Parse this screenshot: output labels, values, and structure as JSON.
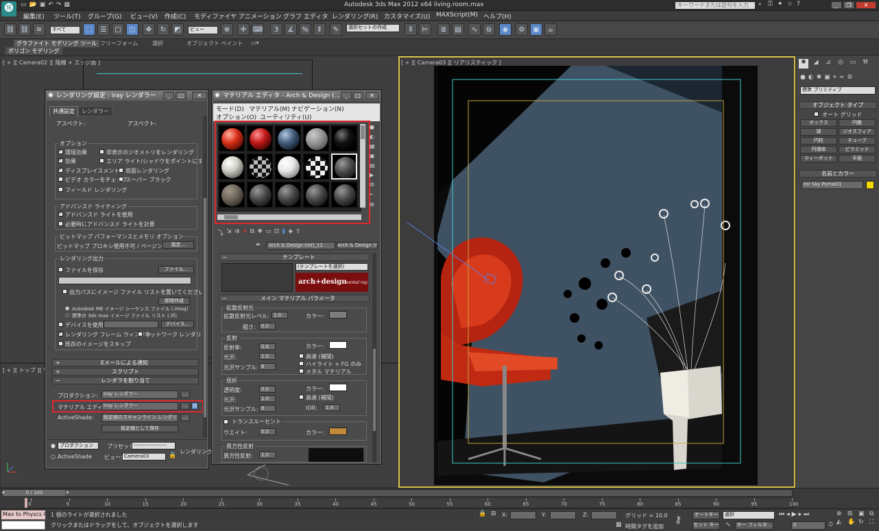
{
  "app": {
    "title": "Autodesk 3ds Max  2012 x64    living.room.max",
    "search_placeholder": "キーワードまたは語句を入力"
  },
  "menu": {
    "items": [
      "編集(E)",
      "ツール(T)",
      "グループ(G)",
      "ビュー(V)",
      "作成(C)",
      "モディファイヤ",
      "アニメーション",
      "グラフ エディタ",
      "レンダリング(R)",
      "カスタマイズ(U)",
      "MAXScript(M)",
      "ヘルプ(H)"
    ]
  },
  "toolbar": {
    "selection_filter": "すべて",
    "ref_coord": "ビュー",
    "named_selection": "選択セットの作成"
  },
  "ribbon": {
    "tabs": [
      "グラファイト モデリング ツール",
      "フリーフォーム",
      "選択",
      "オブジェクト ペイント"
    ],
    "subtab": "ポリゴン モデリング"
  },
  "viewports": {
    "top_left_label": "[ + ][ Camera02 ][ 陰線 + エッジ面 ]",
    "bottom_left_label": "[ + ][ トップ ][ ワイヤ",
    "right_label": "[ + ][ Camera03 ][ リアリスティック ]"
  },
  "render_setup": {
    "title": "レンダリング設定 : iray レンダラー",
    "tabs": [
      "共通設定",
      "レンダラー"
    ],
    "aspect_label": "アスペクト:",
    "aspect_label2": "アスペクト:",
    "options": {
      "title": "オプション",
      "atmospherics": "環境効果",
      "render_hidden": "非表示のジオメトリをレンダリング",
      "effects": "効果",
      "area_lights": "エリア ライト/シャドウをポイントにする",
      "displacement": "ディスプレイスメント",
      "force_2sided": "両面レンダリング",
      "video_check": "ビデオ カラーをチェック",
      "super_black": "スーパー ブラック",
      "render_fields": "フィールド レンダリング"
    },
    "advanced_lighting": {
      "title": "アドバンスド ライティング",
      "use": "アドバンスド ライトを使用",
      "compute": "必要時にアドバンスド ライトを計算"
    },
    "bitmap_perf": {
      "title": "ビットマップ パフォーマンスとメモリ オプション",
      "text": "ビットマップ プロキシ使用不可 / ページング使用",
      "setup_btn": "設定..."
    },
    "render_output": {
      "title": "レンダリング出力",
      "save_file": "ファイルを保存",
      "files_btn": "ファイル...",
      "put_image_list": "出力パスにイメージ ファイル リストを置いてください",
      "create_now": "即時作成",
      "autodesk_ml": "Autodesk ME イメージ シーケンス ファイル (.imsq)",
      "legacy": "標準の 3ds max イメージ ファイル リスト (.ifl)",
      "use_device": "デバイスを使用",
      "devices_btn": "デバイス...",
      "frame_window": "レンダリング フレーム ウィンドウ",
      "net_render": "ネットワーク レンダリング",
      "skip_existing": "既存のイメージをスキップ"
    },
    "rollouts": {
      "email": "Eメールによる通知",
      "scripts": "スクリプト",
      "assign": "レンダラを割り当て"
    },
    "assign": {
      "production_label": "プロダクション:",
      "production_value": "iray レンダラー",
      "material_label": "マテリアル エディタ:",
      "material_value": "iray レンダラー",
      "activeshade_label": "ActiveShade:",
      "activeshade_value": "既定値のスキャンライン レンダリング",
      "save_default": "既定値として保存"
    },
    "bottom": {
      "production": "プロダクション",
      "preset_label": "プリセット:",
      "preset_value": "-------------------",
      "activeshade": "ActiveShade",
      "view_label": "ビュー:",
      "view_value": "Camera03",
      "render_btn": "レンダリング"
    }
  },
  "material_editor": {
    "title": "マテリアル エディタ - Arch & Design (...",
    "menu1": [
      "モード(D)",
      "マテリアル(M)",
      "ナビゲーション(N)"
    ],
    "menu2": [
      "オプション(O)",
      "ユーティリティ(U)"
    ],
    "material_name": "Arch & Design (mi)_11",
    "material_type": "Arch & Design (mi)",
    "templates": {
      "title": "テンプレート",
      "dropdown": "(テンプレートを選択)",
      "brand": "arch+design",
      "brand_sub": "mental ray"
    },
    "main": {
      "title": "メイン マテリアル パラメータ",
      "diffuse_title": "拡散反射光",
      "diffuse_level": "拡散反射光レベル:",
      "diffuse_level_val": "1.0",
      "roughness": "粗さ:",
      "roughness_val": "0.0",
      "color": "カラー:",
      "refl_title": "反射",
      "reflectivity": "反射率:",
      "reflectivity_val": "0.6",
      "gloss": "光沢:",
      "gloss_val": "1.0",
      "gloss_samples": "光沢サンプル:",
      "gloss_samples_val": "8",
      "fast_interp": "高速 (補間)",
      "highlights_fg": "ハイライト + FG のみ",
      "metal": "メタル マテリアル",
      "refr_title": "屈折",
      "transparency": "透明度:",
      "transparency_val": "0.0",
      "refr_gloss_val": "1.0",
      "refr_samples_val": "8",
      "ior": "IOR:",
      "ior_val": "1.4",
      "translucency": "トランスルーセント",
      "weight": "ウエイト:",
      "weight_val": "0.5",
      "aniso_title": "異方性反射",
      "aniso": "異方性反射:",
      "aniso_val": "1.0"
    }
  },
  "command_panel": {
    "category": "標準 プリミティブ",
    "object_type_title": "オブジェクト タイプ",
    "autogrid": "オート グリッド",
    "buttons": [
      "ボックス",
      "円錐",
      "球",
      "ジオスフィア",
      "円柱",
      "チューブ",
      "円環体",
      "ピラミッド",
      "ティーポット",
      "平面"
    ],
    "name_color_title": "名前とカラー",
    "object_name": "mr Sky Portal01"
  },
  "timeline": {
    "frame": "0 / 100",
    "ticks": [
      "0",
      "5",
      "10",
      "15",
      "20",
      "25",
      "30",
      "35",
      "40",
      "45",
      "50",
      "55",
      "60",
      "65",
      "70",
      "75",
      "80",
      "85",
      "90",
      "95",
      "100"
    ]
  },
  "status": {
    "maxscript": "Max to Physcs C",
    "message1": "1 個のライトが選択されました",
    "message2": "クリックまたはドラッグをして、オブジェクトを選択します",
    "x_label": "X:",
    "y_label": "Y:",
    "z_label": "Z:",
    "grid": "グリッド = 10.0",
    "add_time_tag": "時間タグを追加",
    "auto_key": "オートキー",
    "selected": "選択",
    "set_key": "セット キー",
    "key_filters": "キー フィルタ...",
    "frame_field": "0"
  },
  "colors": {
    "accent": "#5b86c8",
    "highlight_red": "#e0282c",
    "viewport_border": "#d9c04a"
  }
}
